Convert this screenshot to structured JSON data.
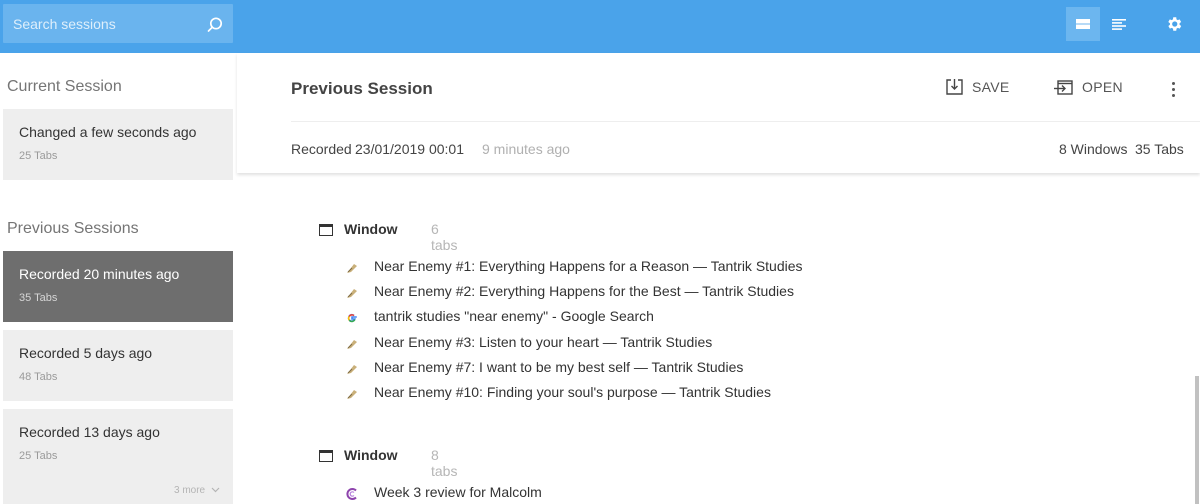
{
  "search": {
    "placeholder": "Search sessions"
  },
  "toolbar": {
    "icons": [
      "search-icon",
      "list-view-icon",
      "detail-view-icon",
      "gear-icon"
    ]
  },
  "sidebar": {
    "current_title": "Current Session",
    "current": {
      "title": "Changed a few seconds ago",
      "sub": "25 Tabs"
    },
    "previous_title": "Previous Sessions",
    "previous": [
      {
        "title": "Recorded 20 minutes ago",
        "sub": "35 Tabs",
        "selected": true
      },
      {
        "title": "Recorded 5 days ago",
        "sub": "48 Tabs"
      },
      {
        "title": "Recorded 13 days ago",
        "sub": "25 Tabs"
      }
    ],
    "more": "3 more"
  },
  "main": {
    "title": "Previous Session",
    "save_label": "SAVE",
    "open_label": "OPEN",
    "recorded_label": "Recorded",
    "recorded_date": "23/01/2019 00:01",
    "recorded_ago": "9 minutes ago",
    "windows_count": "8 Windows",
    "tabs_count": "35 Tabs",
    "windows": [
      {
        "label": "Window",
        "count": "6 tabs",
        "tabs": [
          {
            "title": "Near Enemy #1: Everything Happens for a Reason — Tantrik Studies",
            "icon": "tantrik-favicon-icon"
          },
          {
            "title": "Near Enemy #2: Everything Happens for the Best — Tantrik Studies",
            "icon": "tantrik-favicon-icon"
          },
          {
            "title": "tantrik studies \"near enemy\" - Google Search",
            "icon": "google-favicon-icon"
          },
          {
            "title": "Near Enemy #3: Listen to your heart — Tantrik Studies",
            "icon": "tantrik-favicon-icon"
          },
          {
            "title": "Near Enemy #7: I want to be my best self — Tantrik Studies",
            "icon": "tantrik-favicon-icon"
          },
          {
            "title": "Near Enemy #10: Finding your soul's purpose — Tantrik Studies",
            "icon": "tantrik-favicon-icon"
          }
        ]
      },
      {
        "label": "Window",
        "count": "8 tabs",
        "tabs": [
          {
            "title": "Week 3 review for Malcolm",
            "icon": "c-favicon-icon"
          }
        ]
      }
    ]
  },
  "colors": {
    "topbar": "#4aa3ea",
    "selected_card": "#6e6e6e",
    "card": "#eeeeee"
  }
}
